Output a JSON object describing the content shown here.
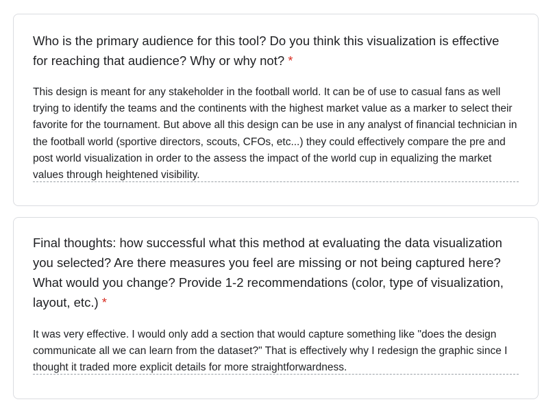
{
  "form": {
    "questions": [
      {
        "question": "Who is the primary audience for this tool?  Do you think this visualization is effective for reaching that audience?  Why or why not?",
        "required_marker": "*",
        "answer": "This design is meant for any stakeholder in the football world. It can be of use to casual fans as well trying to identify the teams and the continents with the highest market value as a marker to select their favorite for the tournament. But above all this design can be use in any analyst of financial technician in the football world (sportive directors, scouts, CFOs, etc...) they could effectively compare the pre and post world visualization in order to the assess the impact of the world cup in equalizing the market values through heightened visibility."
      },
      {
        "question": "Final thoughts: how successful what this method at evaluating the data visualization you selected? Are there measures you feel are missing or not being captured here?  What would you change?  Provide 1-2 recommendations (color, type of visualization, layout, etc.)",
        "required_marker": "*",
        "answer": "It was very effective. I would only add a section that would capture something like \"does the design communicate all we can learn from the dataset?\" That is effectively why I redesign the graphic since I thought it traded more explicit details for more straightforwardness."
      }
    ]
  }
}
